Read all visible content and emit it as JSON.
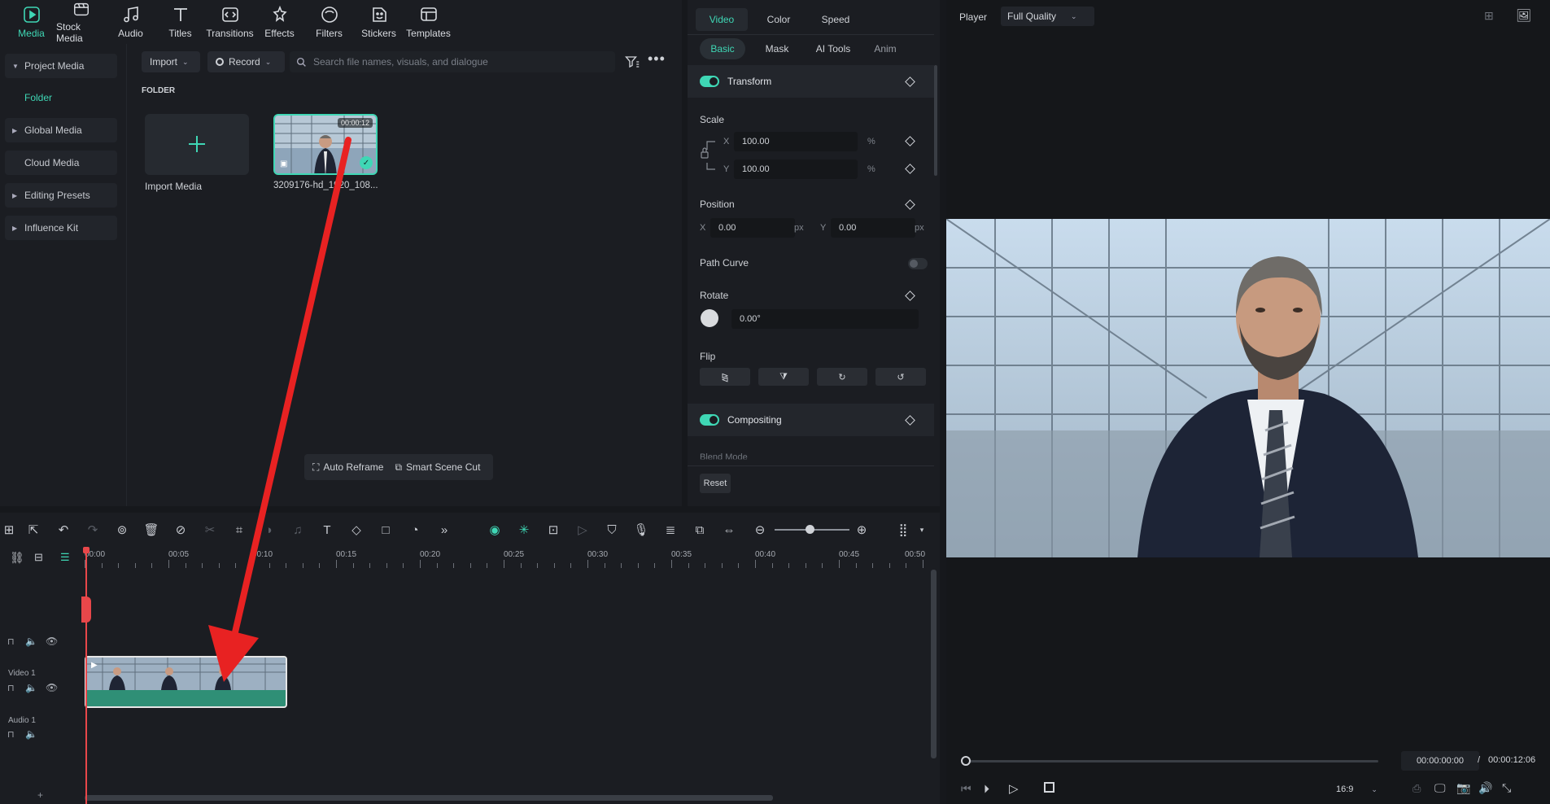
{
  "toptabs": [
    {
      "label": "Media",
      "icon": "media-icon"
    },
    {
      "label": "Stock Media",
      "icon": "stock-media-icon"
    },
    {
      "label": "Audio",
      "icon": "music-note-icon"
    },
    {
      "label": "Titles",
      "icon": "text-t-icon"
    },
    {
      "label": "Transitions",
      "icon": "transition-icon"
    },
    {
      "label": "Effects",
      "icon": "effects-icon"
    },
    {
      "label": "Filters",
      "icon": "filter-icon"
    },
    {
      "label": "Stickers",
      "icon": "sticker-icon"
    },
    {
      "label": "Templates",
      "icon": "template-icon"
    }
  ],
  "sidebar": {
    "project_media": "Project Media",
    "folder": "Folder",
    "global_media": "Global Media",
    "cloud_media": "Cloud Media",
    "editing_presets": "Editing Presets",
    "influence_kit": "Influence Kit"
  },
  "media": {
    "import_label": "Import",
    "record_label": "Record",
    "search_placeholder": "Search file names, visuals, and dialogue",
    "folder_heading": "FOLDER",
    "import_media": "Import Media",
    "clip_name": "3209176-hd_1920_108...",
    "clip_duration": "00:00:12",
    "auto_reframe": "Auto Reframe",
    "smart_scene_cut": "Smart Scene Cut"
  },
  "props": {
    "tabs": {
      "video": "Video",
      "color": "Color",
      "speed": "Speed"
    },
    "subtabs": {
      "basic": "Basic",
      "mask": "Mask",
      "ai_tools": "AI Tools",
      "anim": "Anim"
    },
    "transform": "Transform",
    "scale": "Scale",
    "scale_x": "100.00",
    "scale_y": "100.00",
    "percent": "%",
    "x": "X",
    "y": "Y",
    "position": "Position",
    "pos_x": "0.00",
    "pos_y": "0.00",
    "px": "px",
    "path_curve": "Path Curve",
    "rotate": "Rotate",
    "rotate_value": "0.00°",
    "flip": "Flip",
    "compositing": "Compositing",
    "blend_mode": "Blend Mode",
    "reset": "Reset"
  },
  "timeline": {
    "ticks": [
      "00:00",
      "00:05",
      "00:10",
      "00:15",
      "00:20",
      "00:25",
      "00:30",
      "00:35",
      "00:40",
      "00:45",
      "00:50"
    ],
    "video_track": "Video 1",
    "audio_track": "Audio 1"
  },
  "player": {
    "label": "Player",
    "quality": "Full Quality",
    "current_time": "00:00:00:00",
    "separator": "/",
    "total_time": "00:00:12:06",
    "aspect": "16:9"
  },
  "colors": {
    "accent": "#3fd7b5",
    "playhead": "#e8474a",
    "arrow": "#e82222"
  }
}
